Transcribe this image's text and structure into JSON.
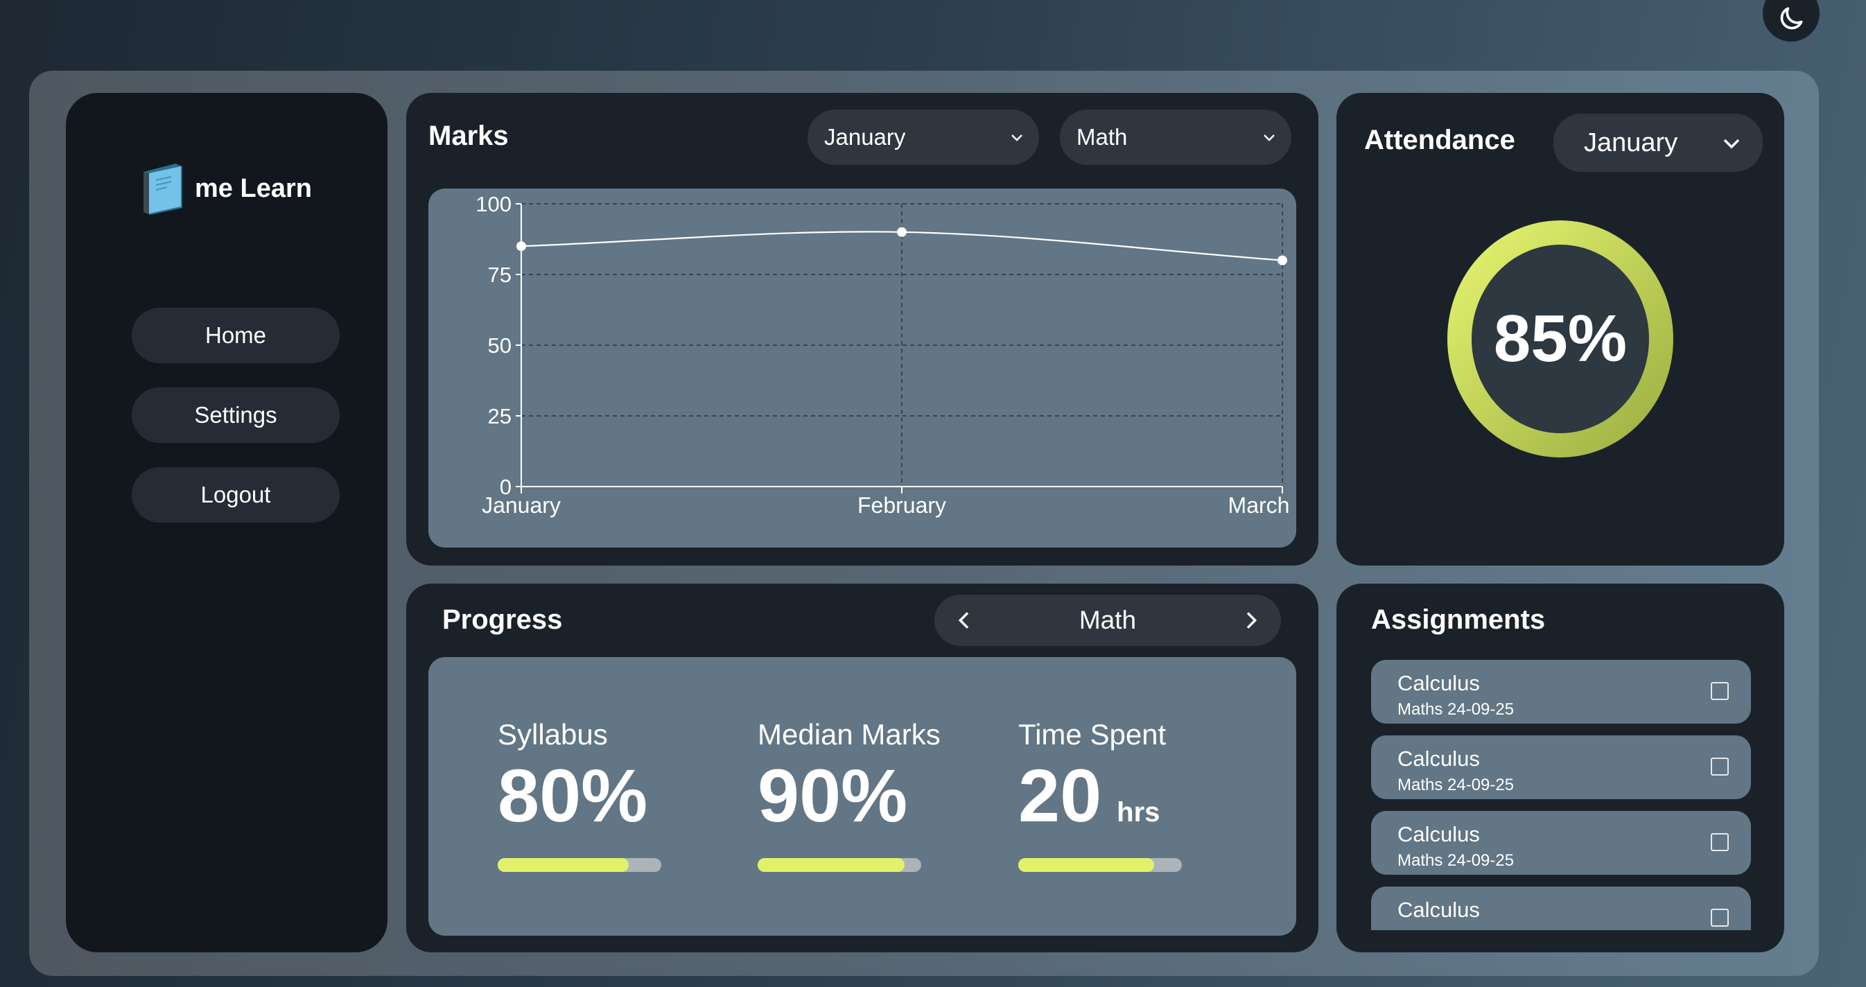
{
  "brand": {
    "name": "me Learn",
    "logo_icon": "book-icon"
  },
  "theme_toggle": {
    "icon": "moon-icon"
  },
  "sidebar": {
    "items": [
      {
        "label": "Home"
      },
      {
        "label": "Settings"
      },
      {
        "label": "Logout"
      }
    ]
  },
  "marks": {
    "title": "Marks",
    "month_select": "January",
    "subject_select": "Math"
  },
  "chart_data": {
    "type": "line",
    "categories": [
      "January",
      "February",
      "March"
    ],
    "values": [
      85,
      90,
      80
    ],
    "ylim": [
      0,
      100
    ],
    "yticks": [
      0,
      25,
      50,
      75,
      100
    ],
    "grid": true,
    "title": "",
    "xlabel": "",
    "ylabel": ""
  },
  "attendance": {
    "title": "Attendance",
    "month_select": "January",
    "value_text": "85%",
    "value": 0.85
  },
  "progress": {
    "title": "Progress",
    "subject": "Math",
    "stats": [
      {
        "label": "Syllabus",
        "value": "80%",
        "unit": "",
        "fraction": 0.8
      },
      {
        "label": "Median Marks",
        "value": "90%",
        "unit": "",
        "fraction": 0.9
      },
      {
        "label": "Time Spent",
        "value": "20",
        "unit": "hrs",
        "fraction": 0.83
      }
    ]
  },
  "assignments": {
    "title": "Assignments",
    "items": [
      {
        "title": "Calculus",
        "subtitle": "Maths 24-09-25",
        "checked": false
      },
      {
        "title": "Calculus",
        "subtitle": "Maths 24-09-25",
        "checked": false
      },
      {
        "title": "Calculus",
        "subtitle": "Maths 24-09-25",
        "checked": false
      },
      {
        "title": "Calculus",
        "subtitle": "",
        "checked": false
      }
    ]
  },
  "colors": {
    "accent": "#e2f16a",
    "card_bg": "#1b2129",
    "inner_bg": "#627685"
  }
}
